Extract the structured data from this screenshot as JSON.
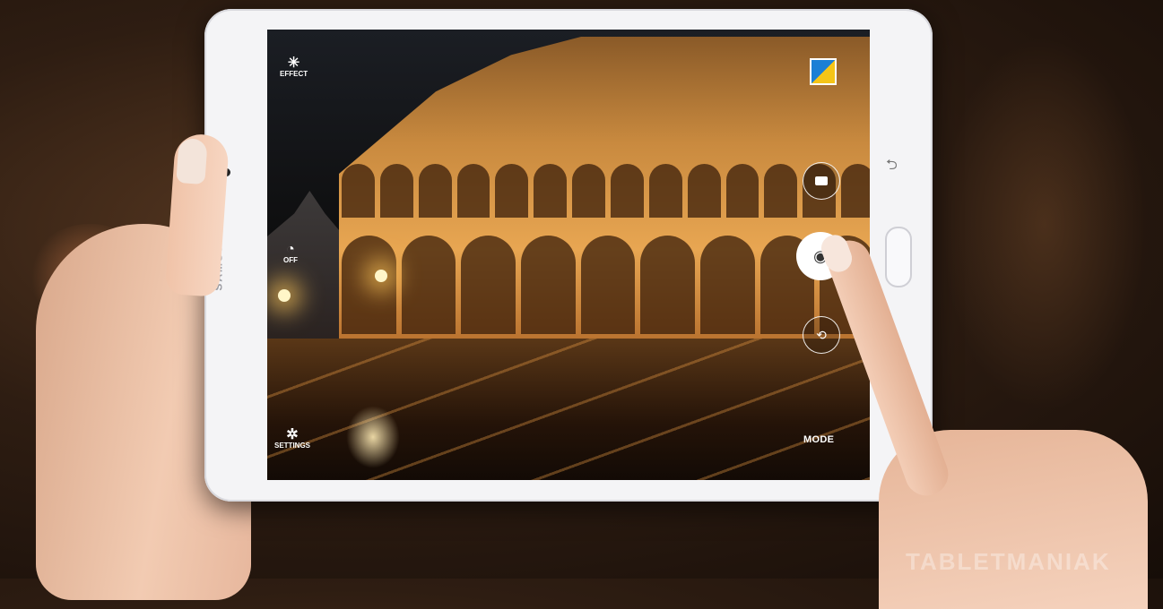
{
  "device": {
    "brand": "SAMSUNG"
  },
  "camera_ui": {
    "effect_label": "EFFECT",
    "timer_label": "OFF",
    "settings_label": "SETTINGS",
    "mode_label": "MODE",
    "icons": {
      "effect": "magic-wand-icon",
      "timer": "timer-icon",
      "settings": "gear-icon",
      "video": "video-record-icon",
      "shutter": "camera-shutter-icon",
      "switch_camera": "switch-camera-icon",
      "gallery": "gallery-thumbnail"
    }
  },
  "watermark": "TABLETMANIAK"
}
